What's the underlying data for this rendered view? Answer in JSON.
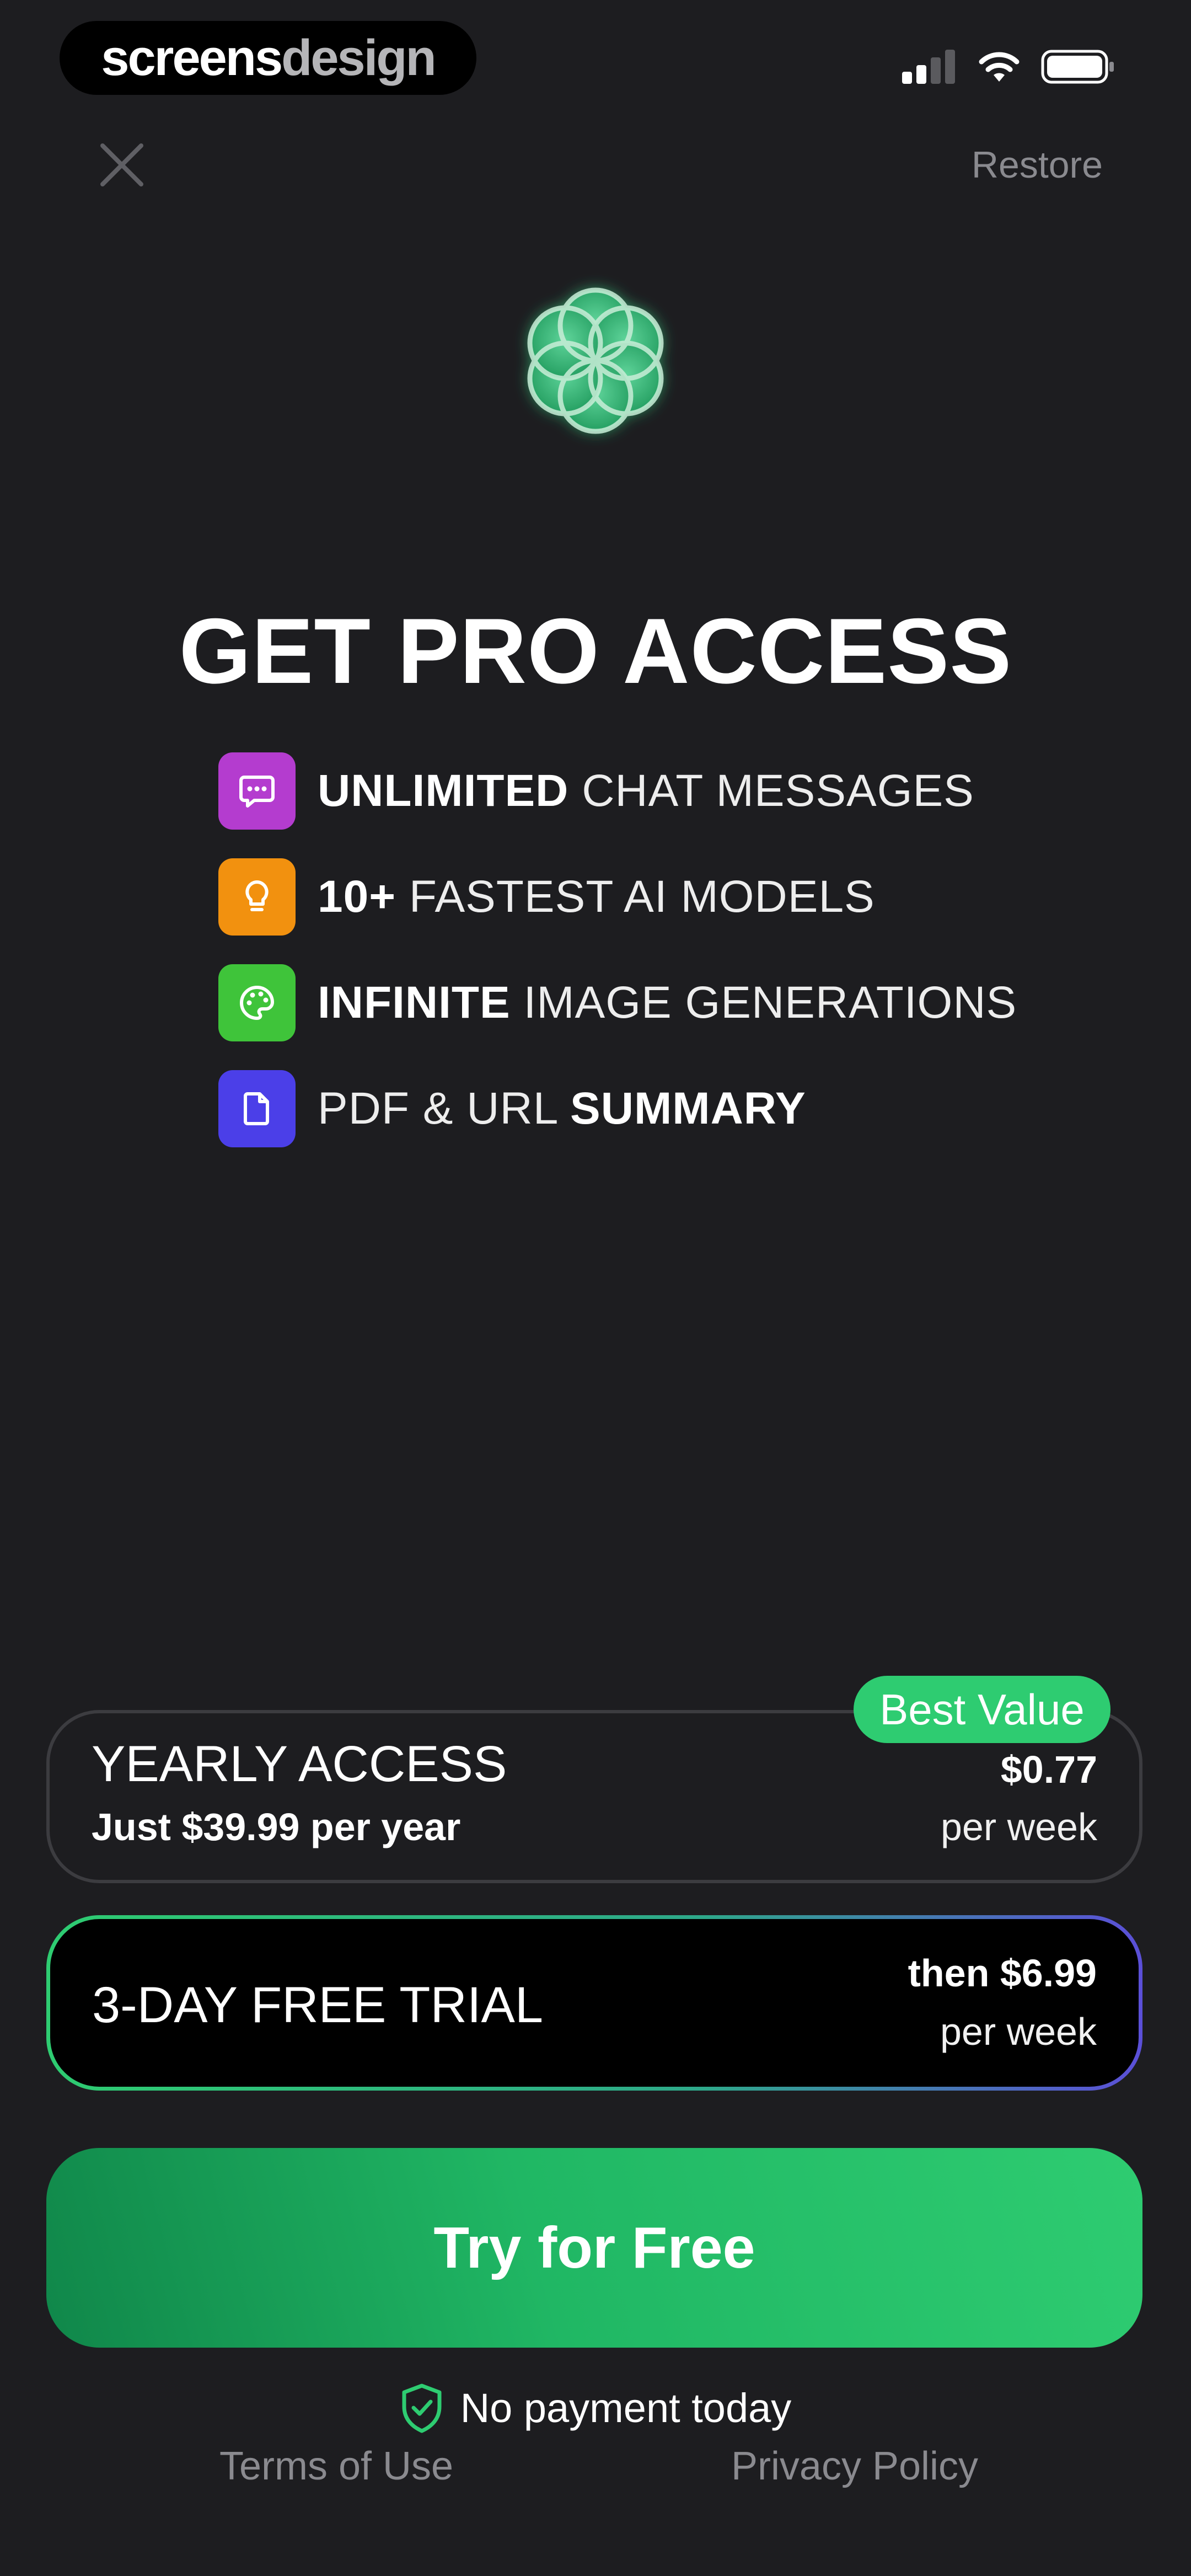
{
  "watermark": {
    "part1": "screens",
    "part2": "design"
  },
  "status_bar": {
    "icons": [
      "signal-icon",
      "wifi-icon",
      "battery-icon"
    ]
  },
  "header": {
    "close_icon": "close-icon",
    "restore_label": "Restore"
  },
  "hero": {
    "logo_icon": "flower-of-life-logo",
    "title": "GET PRO ACCESS"
  },
  "features": [
    {
      "bold": "UNLIMITED",
      "rest": " CHAT MESSAGES",
      "icon": "chat-bubble-icon",
      "color": "#b43ccf"
    },
    {
      "bold": "10+",
      "rest": " FASTEST AI MODELS",
      "icon": "lightbulb-icon",
      "color": "#f2910f"
    },
    {
      "bold": "INFINITE",
      "rest": " IMAGE GENERATIONS",
      "icon": "palette-icon",
      "color": "#3fc43a"
    },
    {
      "pre": "PDF & URL ",
      "bold": "SUMMARY",
      "icon": "document-icon",
      "color": "#4b3fe8"
    }
  ],
  "plans": {
    "yearly": {
      "badge": "Best Value",
      "name": "YEARLY ACCESS",
      "subtitle": "Just $39.99 per year",
      "price": "$0.77",
      "period": "per week"
    },
    "trial": {
      "name": "3-DAY FREE TRIAL",
      "price": "then $6.99",
      "period": "per week"
    }
  },
  "cta": {
    "label": "Try for Free"
  },
  "footer": {
    "no_payment": "No payment today",
    "shield_icon": "shield-check-icon",
    "terms": "Terms of Use",
    "privacy": "Privacy Policy"
  },
  "colors": {
    "background": "#1d1d20",
    "accent": "#2ecc71",
    "muted": "#8a8a8f"
  }
}
